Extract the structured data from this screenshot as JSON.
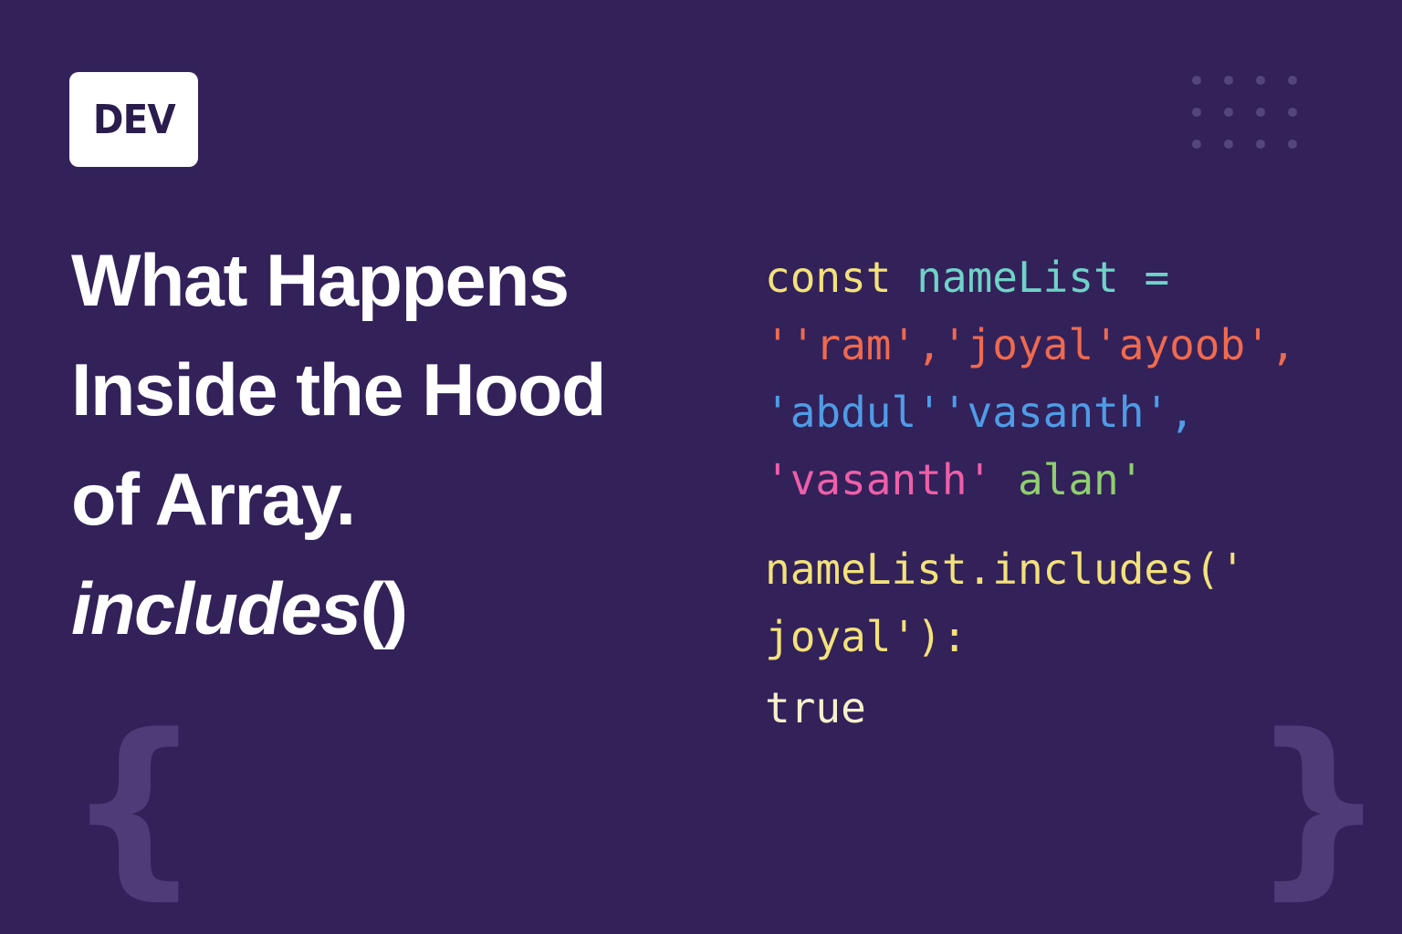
{
  "logo": {
    "text": "DEV"
  },
  "title": {
    "line1": "What Happens",
    "line2": "Inside the Hood",
    "line3": "of Array.",
    "line4_italic": "includes",
    "line4_rest": "()"
  },
  "code": {
    "l1": {
      "keyword": "const",
      "name": "nameList",
      "op": "="
    },
    "l2": {
      "text": "''ram','joyal'ayoob',",
      "color": "#ee6a4f"
    },
    "l3": {
      "text": "'abdul''vasanth',",
      "color": "#4f9ce6"
    },
    "l4": {
      "part1": "'vasanth'",
      "part2": "alan'",
      "color1": "#ee5fa8",
      "color2": "#8fcf6e"
    },
    "l5": "nameList.includes('",
    "l6": "joyal'):",
    "l7": "true"
  },
  "decor": {
    "left_brace": "{",
    "right_brace": "}",
    "icons": [
      "dot-grid-icon",
      "left-curly-brace-icon",
      "right-curly-brace-icon"
    ]
  },
  "colors": {
    "background": "#33215a",
    "keyword": "#f3e27a",
    "identifier": "#6fd3c7",
    "default_code": "#f2eea7",
    "brace": "#4d3c78"
  }
}
